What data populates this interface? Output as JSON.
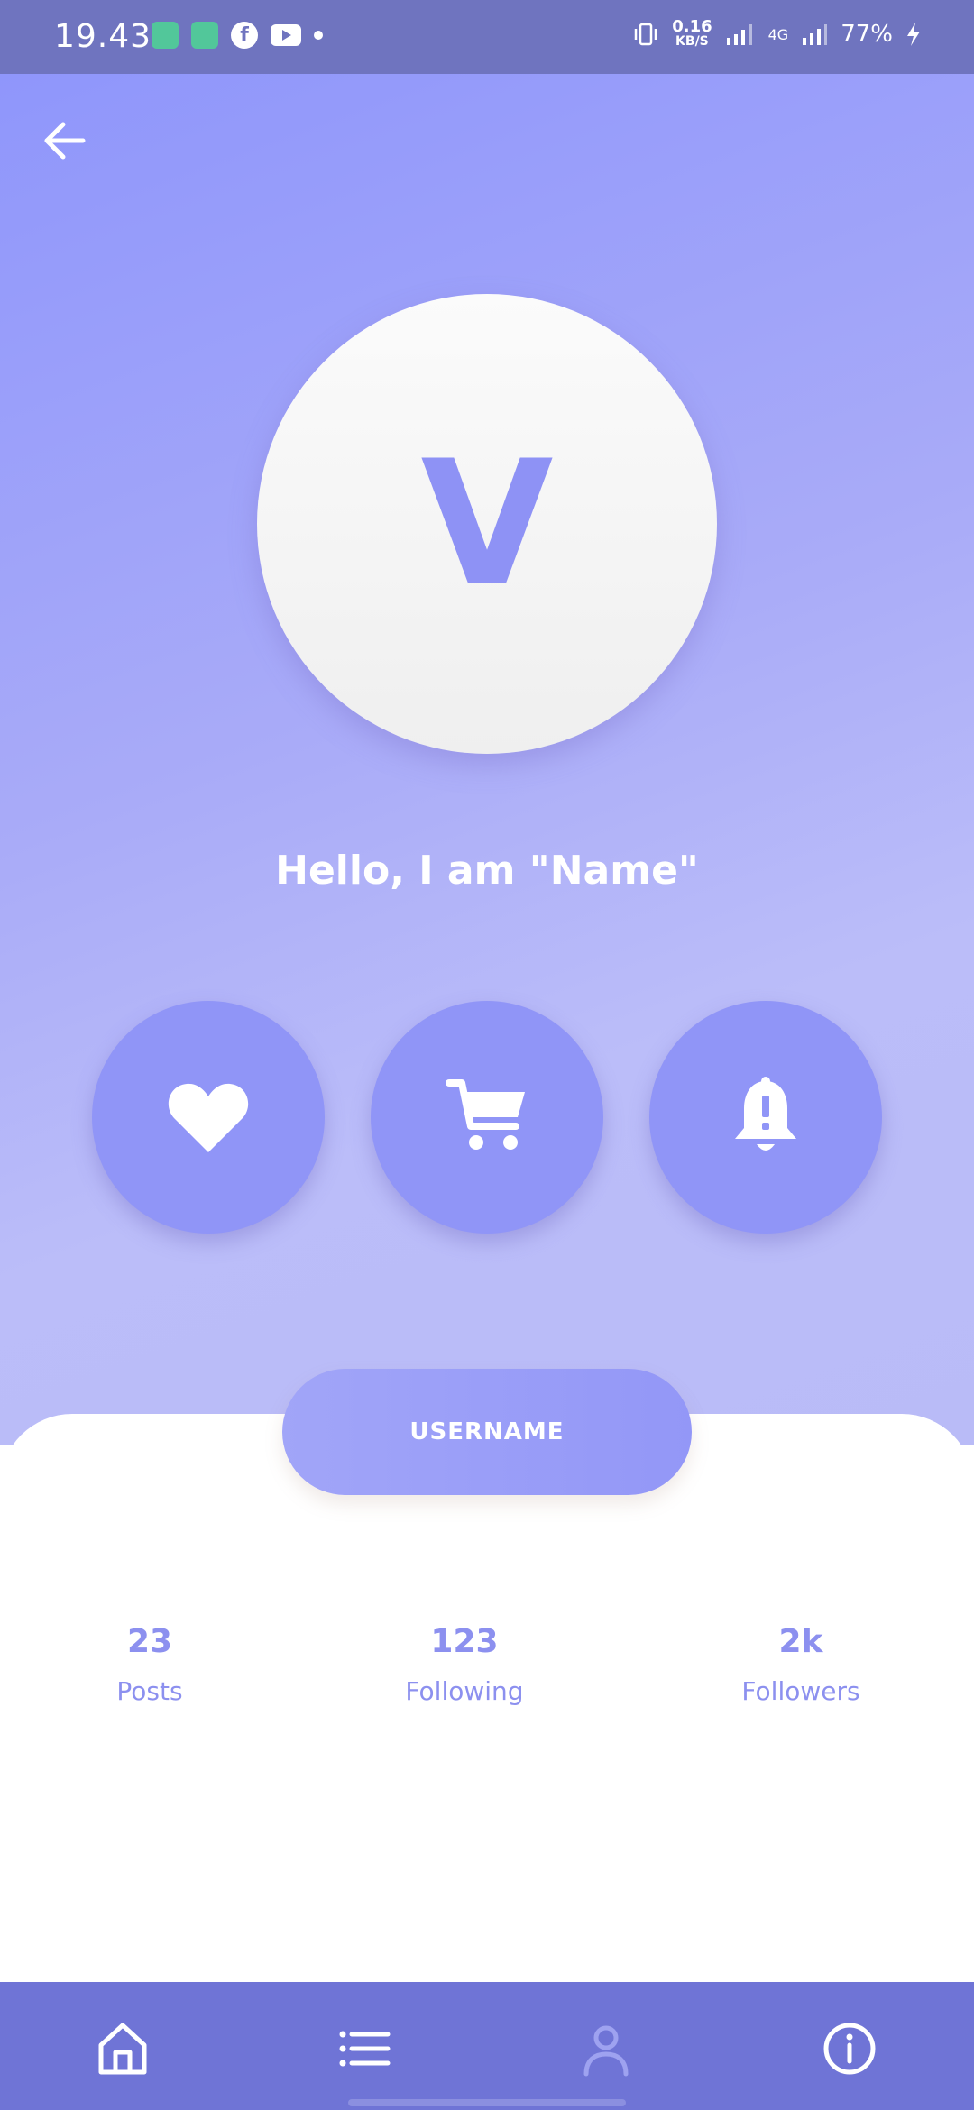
{
  "status_bar": {
    "time": "19.43",
    "net_speed_value": "0.16",
    "net_speed_unit": "KB/S",
    "network_type": "4G",
    "battery": "77%"
  },
  "profile": {
    "avatar_letter": "V",
    "greeting": "Hello, I am \"Name\"",
    "username": "USERNAME"
  },
  "actions": [
    {
      "icon": "heart-icon"
    },
    {
      "icon": "cart-icon"
    },
    {
      "icon": "bell-icon"
    }
  ],
  "stats": {
    "posts": {
      "value": "23",
      "label": "Posts"
    },
    "following": {
      "value": "123",
      "label": "Following"
    },
    "followers": {
      "value": "2k",
      "label": "Followers"
    }
  },
  "bottom_nav": [
    {
      "icon": "home-icon"
    },
    {
      "icon": "list-icon"
    },
    {
      "icon": "profile-icon",
      "active": true
    },
    {
      "icon": "info-icon"
    }
  ],
  "colors": {
    "accent": "#8f96fb",
    "nav_bg": "#6f74d6",
    "status_bg": "#6f74bf",
    "stat_text": "#8c90ef"
  }
}
